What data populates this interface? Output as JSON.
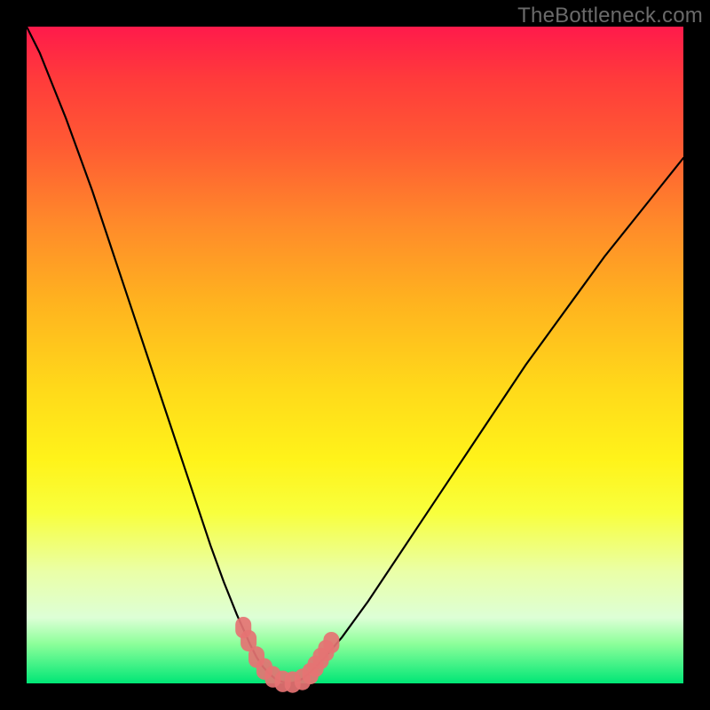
{
  "watermark": "TheBottleneck.com",
  "chart_data": {
    "type": "line",
    "title": "",
    "xlabel": "",
    "ylabel": "",
    "xlim": [
      0,
      100
    ],
    "ylim": [
      0,
      100
    ],
    "x": [
      0,
      2,
      4,
      6,
      8,
      10,
      12,
      14,
      16,
      18,
      20,
      22,
      24,
      26,
      28,
      30,
      32,
      34,
      35,
      36,
      37,
      38,
      39,
      40,
      41,
      42,
      43,
      45,
      48,
      52,
      56,
      60,
      64,
      68,
      72,
      76,
      80,
      84,
      88,
      92,
      96,
      100
    ],
    "y": [
      100,
      96,
      91,
      86,
      80.5,
      75,
      69,
      63,
      57,
      51,
      45,
      39,
      33,
      27,
      21,
      15.5,
      10.5,
      6,
      4,
      2.5,
      1.4,
      0.6,
      0.2,
      0,
      0.2,
      0.7,
      1.5,
      3.5,
      7,
      12.5,
      18.5,
      24.5,
      30.5,
      36.5,
      42.5,
      48.5,
      54,
      59.5,
      65,
      70,
      75,
      80
    ],
    "series_name": "bottleneck",
    "markers": [
      {
        "x": 33.0,
        "y": 8.5
      },
      {
        "x": 33.8,
        "y": 6.5
      },
      {
        "x": 35.0,
        "y": 4.0
      },
      {
        "x": 36.2,
        "y": 2.2
      },
      {
        "x": 37.5,
        "y": 1.0
      },
      {
        "x": 39.0,
        "y": 0.3
      },
      {
        "x": 40.5,
        "y": 0.2
      },
      {
        "x": 42.0,
        "y": 0.6
      },
      {
        "x": 43.2,
        "y": 1.5
      },
      {
        "x": 44.0,
        "y": 2.6
      },
      {
        "x": 44.8,
        "y": 3.8
      },
      {
        "x": 45.6,
        "y": 5.0
      },
      {
        "x": 46.4,
        "y": 6.2
      }
    ],
    "marker_radius": 9,
    "colors": {
      "curve": "#000000",
      "markers": "#e57373",
      "gradient_top": "#ff1a4b",
      "gradient_bottom": "#00e676"
    },
    "notes": "V-shaped bottleneck chart with warm-to-green vertical gradient background; minimum of curve near x≈40, y≈0. Pink lozenge-shaped markers cluster around the trough."
  },
  "layout": {
    "image_size": 800,
    "plot_inset": 30,
    "plot_size": 740
  }
}
